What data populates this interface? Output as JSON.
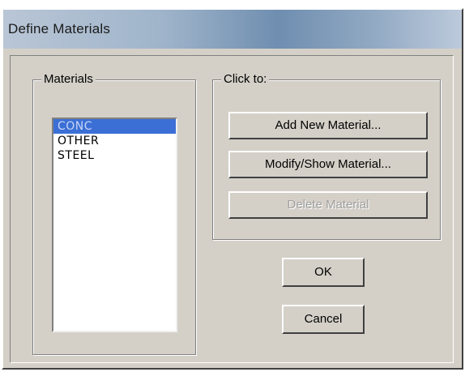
{
  "window": {
    "title": "Define Materials"
  },
  "materials_group": {
    "legend": "Materials",
    "items": [
      {
        "label": "CONC",
        "selected": true
      },
      {
        "label": "OTHER",
        "selected": false
      },
      {
        "label": "STEEL",
        "selected": false
      }
    ]
  },
  "actions_group": {
    "legend": "Click to:",
    "add_label": "Add New Material...",
    "modify_label": "Modify/Show Material...",
    "delete_label": "Delete Material",
    "delete_enabled": false
  },
  "footer": {
    "ok_label": "OK",
    "cancel_label": "Cancel"
  },
  "colors": {
    "dialog_face": "#d4d0c8",
    "selection": "#3b6fd6",
    "title_gradient_mid": "#6f8eb0"
  }
}
